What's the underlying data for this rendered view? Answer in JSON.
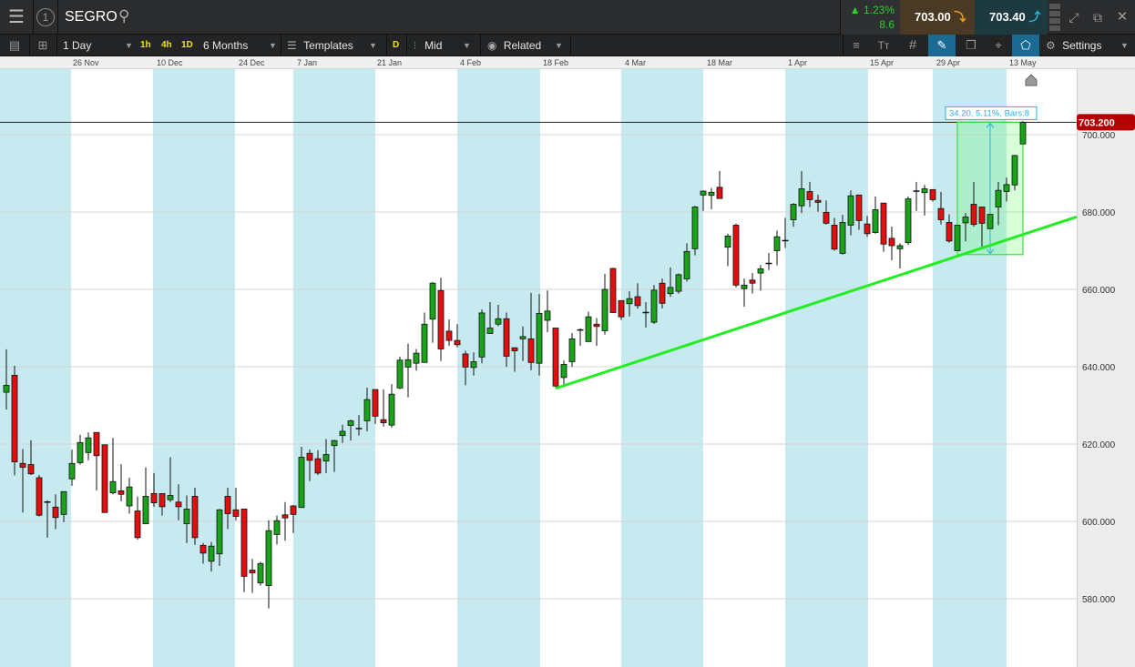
{
  "header": {
    "instrument": "SEGRO",
    "change_pct": "1.23%",
    "change_abs": "8.6",
    "sell_price": "703.00",
    "buy_price": "703.40"
  },
  "toolbar": {
    "interval": "1 Day",
    "quick_1h": "1h",
    "quick_4h": "4h",
    "quick_1d": "1D",
    "range": "6 Months",
    "templates": "Templates",
    "d_badge": "D",
    "price_type": "Mid",
    "related": "Related",
    "settings": "Settings"
  },
  "colors": {
    "up": "#1aa31a",
    "down": "#e01010",
    "band": "#c6eaf0",
    "trendline": "#22ee22",
    "current": "#b30000",
    "accent": "#1b6a94"
  },
  "chart_data": {
    "type": "candlestick",
    "title": "SEGRO 1 Day",
    "ylim": [
      566,
      714
    ],
    "y_ticks": [
      {
        "v": 580,
        "label": "580.000"
      },
      {
        "v": 600,
        "label": "600.000"
      },
      {
        "v": 620,
        "label": "620.000"
      },
      {
        "v": 640,
        "label": "640.000"
      },
      {
        "v": 660,
        "label": "660.000"
      },
      {
        "v": 680,
        "label": "680.000"
      },
      {
        "v": 700,
        "label": "700.000"
      }
    ],
    "x_labels": [
      "26 Nov",
      "10 Dec",
      "24 Dec",
      "7 Jan",
      "21 Jan",
      "4 Feb",
      "18 Feb",
      "4 Mar",
      "18 Mar",
      "1 Apr",
      "15 Apr",
      "29 Apr",
      "13 May"
    ],
    "current_price": 703.2,
    "current_label": "703.200",
    "trendline": {
      "bar1": 67,
      "price1": 634.4,
      "bar2": 116,
      "price2": 668.6
    },
    "measure": {
      "bar_from": 116,
      "bar_to": 124,
      "price_low": 669.0,
      "price_high": 703.2,
      "label": "34.20, 5.11%, Bars:8"
    },
    "ohlc": [
      [
        633.4,
        644.5,
        628.9,
        635.2
      ],
      [
        637.8,
        640.2,
        611.9,
        615.4
      ],
      [
        615,
        618.7,
        602.3,
        614
      ],
      [
        614.7,
        621,
        612,
        612.3
      ],
      [
        611.3,
        612,
        601.3,
        601.6
      ],
      [
        605,
        605.4,
        595.8,
        605
      ],
      [
        603.7,
        607,
        598,
        601
      ],
      [
        601.8,
        607.8,
        599.8,
        607.7
      ],
      [
        611,
        618.6,
        609.2,
        615
      ],
      [
        615.2,
        622.4,
        614.7,
        620.4
      ],
      [
        617.8,
        623,
        615.8,
        621.6
      ],
      [
        623,
        623,
        608,
        617
      ],
      [
        619.8,
        619.8,
        602.3,
        602.3
      ],
      [
        607.4,
        621.6,
        607,
        610.3
      ],
      [
        607.9,
        614.8,
        605.2,
        607
      ],
      [
        604,
        611.3,
        602,
        608.9
      ],
      [
        602.7,
        606.4,
        595.3,
        595.8
      ],
      [
        599.4,
        614,
        599.4,
        606.5
      ],
      [
        607.2,
        612.5,
        603.8,
        604.8
      ],
      [
        607.2,
        607.2,
        601.5,
        603.8
      ],
      [
        605.6,
        616.6,
        605,
        606.7
      ],
      [
        605,
        609.6,
        600.3,
        603.8
      ],
      [
        599.4,
        606.7,
        594.4,
        603.2
      ],
      [
        606.5,
        608.7,
        593.9,
        595.8
      ],
      [
        593.8,
        594.4,
        589.1,
        591.8
      ],
      [
        589.7,
        594.7,
        587,
        593.6
      ],
      [
        591.6,
        603.2,
        588.5,
        603
      ],
      [
        606.5,
        608.7,
        598,
        602
      ],
      [
        603,
        608.7,
        600.3,
        601.3
      ],
      [
        603.2,
        603.2,
        581.7,
        585.8
      ],
      [
        587.4,
        590.3,
        581.5,
        586.7
      ],
      [
        584.1,
        589.6,
        583.4,
        589.1
      ],
      [
        583.4,
        600.3,
        577.5,
        597.6
      ],
      [
        596.6,
        601.5,
        594,
        600.2
      ],
      [
        601.7,
        605,
        595,
        600.9
      ],
      [
        604,
        604.2,
        597,
        601.8
      ],
      [
        603.6,
        619.3,
        603.6,
        616.6
      ],
      [
        617.6,
        618.6,
        610.4,
        615.8
      ],
      [
        616.2,
        618.4,
        612,
        612.5
      ],
      [
        615.6,
        621.3,
        612.5,
        617.3
      ],
      [
        619.6,
        621.1,
        612.8,
        620.9
      ],
      [
        622.2,
        625,
        620.3,
        623.3
      ],
      [
        624.8,
        626.3,
        620.9,
        626
      ],
      [
        624,
        627.5,
        622.2,
        624
      ],
      [
        626,
        634.6,
        623.3,
        631.5
      ],
      [
        634.1,
        634.1,
        625.2,
        627.2
      ],
      [
        626.3,
        634.1,
        624.5,
        625.5
      ],
      [
        624.9,
        635.5,
        624.2,
        632.9
      ],
      [
        634.5,
        642.6,
        634.2,
        641.7
      ],
      [
        639.9,
        646,
        632.1,
        641.8
      ],
      [
        640.9,
        644.6,
        639,
        643.5
      ],
      [
        641.1,
        654,
        641.1,
        651
      ],
      [
        652.3,
        661.9,
        646.2,
        661.6
      ],
      [
        659.7,
        663,
        641.5,
        644.6
      ],
      [
        649.2,
        652.2,
        645.4,
        646.8
      ],
      [
        646.8,
        651,
        645,
        645.7
      ],
      [
        643.3,
        644.1,
        635.2,
        639.9
      ],
      [
        639.8,
        643.7,
        637.7,
        641.3
      ],
      [
        642.5,
        654.8,
        640.9,
        653.9
      ],
      [
        648.6,
        656.7,
        648.6,
        650
      ],
      [
        651,
        656,
        650.5,
        652.4
      ],
      [
        652.4,
        654,
        639.9,
        642.7
      ],
      [
        644.9,
        644.9,
        638.7,
        644.1
      ],
      [
        647.2,
        650.4,
        641.5,
        647.8
      ],
      [
        647.2,
        659.1,
        639.1,
        641.1
      ],
      [
        640.9,
        658.8,
        637.7,
        653.8
      ],
      [
        652,
        659.7,
        648.9,
        654.4
      ],
      [
        650,
        650,
        634.4,
        635
      ],
      [
        637.2,
        641.6,
        635.4,
        640.6
      ],
      [
        641.3,
        648.7,
        640,
        647.2
      ],
      [
        649.5,
        649.9,
        645.4,
        649.5
      ],
      [
        646.5,
        654.2,
        646.5,
        652.9
      ],
      [
        651,
        652.6,
        645.4,
        650.4
      ],
      [
        649.3,
        664,
        648.3,
        660
      ],
      [
        665.4,
        665.6,
        654,
        654
      ],
      [
        657.1,
        657.1,
        652.1,
        652.9
      ],
      [
        656.3,
        659.5,
        653,
        657.6
      ],
      [
        658.1,
        661.6,
        655,
        655.8
      ],
      [
        654,
        656.7,
        650.1,
        654
      ],
      [
        651.5,
        661.1,
        651.1,
        659.8
      ],
      [
        661.6,
        662.8,
        655.1,
        656.4
      ],
      [
        658.9,
        665.7,
        658.1,
        660.5
      ],
      [
        659.5,
        664.1,
        658.9,
        663.8
      ],
      [
        662.7,
        671.9,
        662,
        669.8
      ],
      [
        670.5,
        681.6,
        668.8,
        681.3
      ],
      [
        684.4,
        685.6,
        680.3,
        685.4
      ],
      [
        684.3,
        686.2,
        680.7,
        685.1
      ],
      [
        686.4,
        690.6,
        683.5,
        683.5
      ],
      [
        670.9,
        674.4,
        666,
        673.8
      ],
      [
        676.6,
        677,
        660.5,
        661.1
      ],
      [
        660.2,
        662.8,
        655.5,
        661.1
      ],
      [
        662.4,
        664.2,
        658.9,
        661.6
      ],
      [
        664.2,
        666.3,
        659.7,
        665.3
      ],
      [
        666.7,
        669.4,
        665,
        666.7
      ],
      [
        670,
        675.2,
        666.2,
        673.6
      ],
      [
        672.6,
        678.5,
        670.7,
        672.6
      ],
      [
        678,
        682.3,
        676.2,
        682
      ],
      [
        681.6,
        690.6,
        679.7,
        686
      ],
      [
        685.3,
        687.8,
        681.3,
        683.2
      ],
      [
        683,
        684.5,
        680.1,
        682.5
      ],
      [
        679.9,
        683,
        676.8,
        677.1
      ],
      [
        676.6,
        678.5,
        670,
        670.4
      ],
      [
        669.3,
        679.3,
        669,
        677.3
      ],
      [
        676.6,
        685.6,
        674,
        684.2
      ],
      [
        684.4,
        684.4,
        675.4,
        677.8
      ],
      [
        676.9,
        679,
        673.6,
        674.4
      ],
      [
        674.7,
        684,
        674.4,
        680.6
      ],
      [
        682.3,
        682.3,
        669.7,
        671.7
      ],
      [
        673.2,
        676.2,
        667.5,
        671.3
      ],
      [
        670.5,
        671.9,
        665.4,
        671.3
      ],
      [
        672.1,
        684,
        671.5,
        683.4
      ],
      [
        685.4,
        687.8,
        680.3,
        685.4
      ],
      [
        685,
        687,
        679.1,
        686
      ],
      [
        685.8,
        685.8,
        682.7,
        683.2
      ],
      [
        680.9,
        685.2,
        676.8,
        678
      ],
      [
        677.3,
        679.4,
        672.1,
        672.5
      ],
      [
        670,
        676.6,
        670,
        676.6
      ],
      [
        677.2,
        679.7,
        672.4,
        678.7
      ],
      [
        682,
        687.8,
        676.2,
        676.8
      ],
      [
        681.3,
        681.3,
        670.9,
        677.1
      ],
      [
        675.7,
        679.4,
        675.7,
        679.4
      ],
      [
        681.3,
        687.8,
        676.6,
        685.6
      ],
      [
        685.3,
        688.9,
        682.7,
        687.1
      ],
      [
        687,
        694.8,
        685.6,
        694.6
      ],
      [
        697.6,
        703.5,
        697.6,
        703.2
      ]
    ]
  }
}
